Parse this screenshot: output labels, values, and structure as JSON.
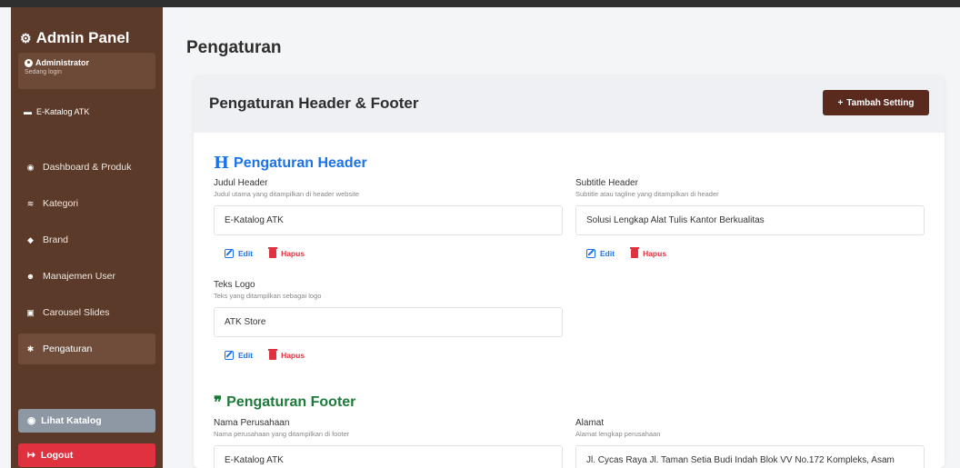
{
  "sidebar": {
    "brand": "Admin Panel",
    "user": {
      "name": "Administrator",
      "status": "Sedang login"
    },
    "catalog_link": "E-Katalog ATK",
    "items": [
      {
        "label": "Dashboard & Produk",
        "icon": "dashboard-icon"
      },
      {
        "label": "Kategori",
        "icon": "layers-icon"
      },
      {
        "label": "Brand",
        "icon": "tag-icon"
      },
      {
        "label": "Manajemen User",
        "icon": "users-icon"
      },
      {
        "label": "Carousel Slides",
        "icon": "image-icon"
      },
      {
        "label": "Pengaturan",
        "icon": "gear-icon",
        "active": true
      }
    ],
    "view_catalog": "Lihat Katalog",
    "logout": "Logout"
  },
  "page": {
    "title": "Pengaturan"
  },
  "card": {
    "title": "Pengaturan Header & Footer",
    "add_button": "Tambah Setting"
  },
  "header_section": {
    "title": "Pengaturan Header",
    "fields": [
      {
        "label": "Judul Header",
        "hint": "Judul utama yang ditampilkan di header website",
        "value": "E-Katalog ATK"
      },
      {
        "label": "Subtitle Header",
        "hint": "Subtitle atau tagline yang ditampilkan di header",
        "value": "Solusi Lengkap Alat Tulis Kantor Berkualitas"
      },
      {
        "label": "Teks Logo",
        "hint": "Teks yang ditampilkan sebagai logo",
        "value": "ATK Store"
      }
    ]
  },
  "footer_section": {
    "title": "Pengaturan Footer",
    "fields": [
      {
        "label": "Nama Perusahaan",
        "hint": "Nama perusahaan yang ditampilkan di footer",
        "value": "E-Katalog ATK"
      },
      {
        "label": "Alamat",
        "hint": "Alamat lengkap perusahaan",
        "value": "Jl. Cycas Raya Jl. Taman Setia Budi Indah Blok VV No.172 Kompleks, Asam"
      }
    ]
  },
  "actions": {
    "edit": "Edit",
    "delete": "Hapus"
  },
  "colors": {
    "sidebar": "#5b3a29",
    "accent_blue": "#1a73e8",
    "accent_green": "#1e7a3a",
    "danger": "#e0313f",
    "add_button": "#5b2a1f"
  }
}
